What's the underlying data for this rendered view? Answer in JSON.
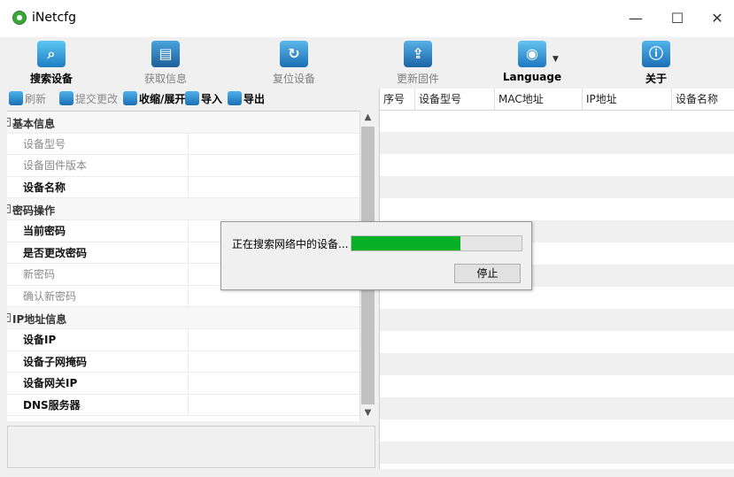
{
  "window": {
    "title": "iNetcfg",
    "minimize": "—",
    "maximize": "☐",
    "close": "✕"
  },
  "toolbar": {
    "items": [
      {
        "label": "搜索设备",
        "icon": "search-icon",
        "state": "active"
      },
      {
        "label": "获取信息",
        "icon": "info-icon",
        "state": "disabled"
      },
      {
        "label": "复位设备",
        "icon": "reset-icon",
        "state": "disabled"
      },
      {
        "label": "更新固件",
        "icon": "firmware-icon",
        "state": "disabled"
      },
      {
        "label": "Language",
        "icon": "globe-icon",
        "state": "active"
      },
      {
        "label": "关于",
        "icon": "about-icon",
        "state": "active"
      }
    ]
  },
  "left_toolbar": {
    "refresh": "刷新",
    "submit": "提交更改",
    "collapse": "收缩/展开",
    "import": "导入",
    "export": "导出"
  },
  "properties": {
    "basic": {
      "title": "基本信息",
      "items": [
        "设备型号",
        "设备固件版本",
        "设备名称"
      ]
    },
    "password": {
      "title": "密码操作",
      "items": [
        "当前密码",
        "是否更改密码",
        "新密码",
        "确认新密码"
      ]
    },
    "ip": {
      "title": "IP地址信息",
      "items": [
        "设备IP",
        "设备子网掩码",
        "设备网关IP",
        "DNS服务器"
      ]
    }
  },
  "device_list": {
    "columns": [
      "序号",
      "设备型号",
      "MAC地址",
      "IP地址",
      "设备名称"
    ]
  },
  "dialog": {
    "message": "正在搜索网络中的设备...",
    "progress": 0.64,
    "stop_label": "停止"
  },
  "colors": {
    "progress": "#06b025",
    "stripe": "#f0f0f0",
    "window_bg": "#f0f0f0"
  }
}
